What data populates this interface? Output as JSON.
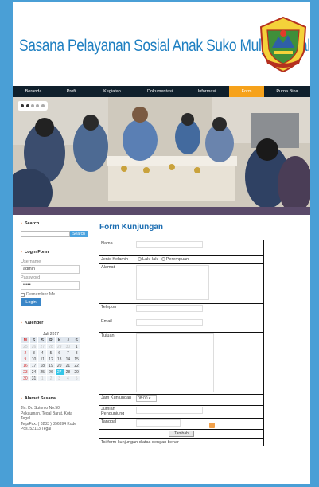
{
  "header": {
    "title": "Sasana Pelayanan Sosial Anak Suko Mulyo Tegal"
  },
  "nav": [
    {
      "label": "Beranda",
      "width": 52
    },
    {
      "label": "Profil",
      "width": 44
    },
    {
      "label": "Kegiatan",
      "width": 58
    },
    {
      "label": "Dokumentasi",
      "width": 62
    },
    {
      "label": "Informasi",
      "width": 56
    },
    {
      "label": "Form",
      "width": 44,
      "active": true
    },
    {
      "label": "Purna Bina",
      "width": 58
    }
  ],
  "sidebar": {
    "search_heading": "Search",
    "search_button": "Search",
    "login_heading": "Login Form",
    "username_label": "Username",
    "username_value": "admin",
    "password_label": "Password",
    "password_value": "•••••",
    "remember_label": "Remember Me",
    "login_button": "Login",
    "calendar_heading": "Kalender",
    "calendar_month": "Juli 2017",
    "calendar_days": [
      "M",
      "S",
      "S",
      "R",
      "K",
      "J",
      "S"
    ],
    "calendar_rows": [
      [
        "25",
        "26",
        "27",
        "28",
        "29",
        "30",
        "1"
      ],
      [
        "2",
        "3",
        "4",
        "5",
        "6",
        "7",
        "8"
      ],
      [
        "9",
        "10",
        "11",
        "12",
        "13",
        "14",
        "15"
      ],
      [
        "16",
        "17",
        "18",
        "19",
        "20",
        "21",
        "22"
      ],
      [
        "23",
        "24",
        "25",
        "26",
        "27",
        "28",
        "29"
      ],
      [
        "30",
        "31",
        "1",
        "2",
        "3",
        "4",
        "5"
      ]
    ],
    "calendar_today": "27",
    "address_heading": "Alamat Sasana",
    "address_lines": [
      "Jln. Dr. Sutomo No.50",
      "Pekauman, Tegal Barat, Kota",
      "Tegal",
      "Telp/Fax. ( 0283 ) 356394 Kode",
      "Pos. 52113 Tegal"
    ]
  },
  "form": {
    "title": "Form Kunjungan",
    "nama": "Nama",
    "jenis_kelamin": "Jenis Kelamin",
    "laki": "Laki-laki",
    "perempuan": "Perempuan",
    "alamat": "Alamat",
    "telepon": "Telepon",
    "email": "Email",
    "tujuan": "Tujuan",
    "jam_kunjungan": "Jam Kunjungan",
    "jam_value": "08:00",
    "jumlah_pengunjung": "Jumlah Pengunjung",
    "tanggal": "Tanggal",
    "submit": "Tambah",
    "note": "Tsi form kunjungan diatas dengan benar"
  }
}
